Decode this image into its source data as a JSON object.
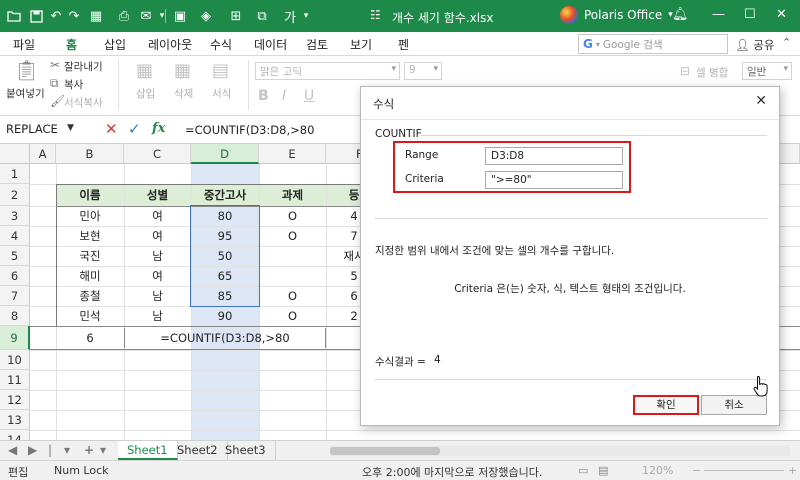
{
  "titlebar": {
    "doc_title": "개수 세기 함수.xlsx",
    "brand": "Polaris Office",
    "accent": "#1e8a4a"
  },
  "tabs": {
    "items": [
      "파일",
      "홈",
      "삽입",
      "레이아웃",
      "수식",
      "데이터",
      "검토",
      "보기",
      "펜"
    ],
    "active": "홈",
    "search_placeholder": "Google 검색",
    "share_label": "공유"
  },
  "ribbon": {
    "paste": "붙여넣기",
    "cut": "잘라내기",
    "copy": "복사",
    "format_copy": "서식복사",
    "insert": "삽입",
    "delete": "삭제",
    "format": "서식",
    "font_name": "맑은 고딕",
    "font_size": "9",
    "merge": "셀 병합",
    "number_format": "일반"
  },
  "formula_bar": {
    "name_box": "REPLACE",
    "fx": "fx",
    "formula": "=COUNTIF(D3:D8,>80"
  },
  "sheet": {
    "columns": [
      "A",
      "B",
      "C",
      "D",
      "E",
      "F"
    ],
    "rows": [
      "1",
      "2",
      "3",
      "4",
      "5",
      "6",
      "7",
      "8",
      "9",
      "10",
      "11",
      "12",
      "13",
      "14"
    ],
    "headers": [
      "이름",
      "성별",
      "중간고사",
      "과제",
      "등"
    ],
    "data": [
      [
        "민아",
        "여",
        "80",
        "O",
        "4"
      ],
      [
        "보현",
        "여",
        "95",
        "O",
        "7"
      ],
      [
        "국진",
        "남",
        "50",
        "",
        "재시"
      ],
      [
        "해미",
        "여",
        "65",
        "",
        "5"
      ],
      [
        "종철",
        "남",
        "85",
        "O",
        "6"
      ],
      [
        "민석",
        "남",
        "90",
        "O",
        "2"
      ]
    ],
    "row9_b": "6",
    "row9_formula": "=COUNTIF(D3:D8,>80"
  },
  "sheet_tabs": {
    "nav_prev": "◀",
    "nav_next": "▶",
    "nav_add": "+",
    "nav_menu": "▾",
    "tabs": [
      "Sheet1",
      "Sheet2",
      "Sheet3"
    ],
    "active": "Sheet1"
  },
  "status": {
    "mode": "편집",
    "numlock": "Num Lock",
    "saved": "오후 2:00에 마지막으로 저장했습니다.",
    "zoom": "120%"
  },
  "dialog": {
    "title": "수식",
    "function_name": "COUNTIF",
    "args": [
      {
        "label": "Range",
        "value": "D3:D8"
      },
      {
        "label": "Criteria",
        "value": "\">=80\""
      }
    ],
    "description": "지정한 범위 내에서 조건에 맞는 셀의 개수를 구합니다.",
    "arg_description": "Criteria 은(는) 숫자, 식, 텍스트 형태의 조건입니다.",
    "result_label": "수식결과 =",
    "result_value": "4",
    "ok_label": "확인",
    "cancel_label": "취소"
  }
}
